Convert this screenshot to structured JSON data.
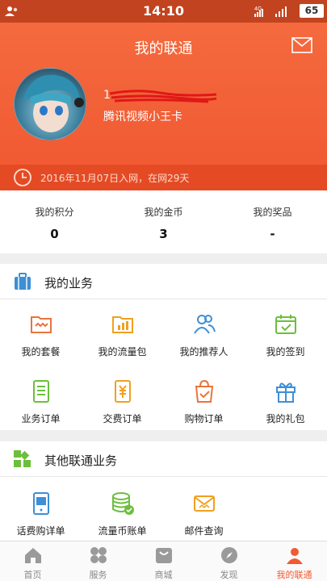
{
  "status_bar": {
    "time": "14:10",
    "battery": "65",
    "network": "4G"
  },
  "header": {
    "title": "我的联通",
    "phone_number": "1",
    "plan_name": "腾讯视频小王卡",
    "join_info": "2016年11月07日入网，在网29天"
  },
  "stats": [
    {
      "label": "我的积分",
      "value": "0"
    },
    {
      "label": "我的金币",
      "value": "3"
    },
    {
      "label": "我的奖品",
      "value": "-"
    }
  ],
  "my_business": {
    "title": "我的业务",
    "items": [
      {
        "label": "我的套餐",
        "icon": "package-icon"
      },
      {
        "label": "我的流量包",
        "icon": "data-pack-icon"
      },
      {
        "label": "我的推荐人",
        "icon": "referrer-icon"
      },
      {
        "label": "我的签到",
        "icon": "checkin-icon"
      },
      {
        "label": "业务订单",
        "icon": "business-order-icon"
      },
      {
        "label": "交费订单",
        "icon": "payment-order-icon"
      },
      {
        "label": "购物订单",
        "icon": "shopping-order-icon"
      },
      {
        "label": "我的礼包",
        "icon": "gift-icon"
      }
    ]
  },
  "other_business": {
    "title": "其他联通业务",
    "items": [
      {
        "label": "话费购详单",
        "icon": "purchase-detail-icon"
      },
      {
        "label": "流量币账单",
        "icon": "coin-bill-icon"
      },
      {
        "label": "邮件查询",
        "icon": "mail-query-icon"
      }
    ]
  },
  "tabs": [
    {
      "label": "首页",
      "icon": "home-icon"
    },
    {
      "label": "服务",
      "icon": "service-icon"
    },
    {
      "label": "商城",
      "icon": "mall-icon"
    },
    {
      "label": "发现",
      "icon": "compass-icon"
    },
    {
      "label": "我的联通",
      "icon": "profile-icon",
      "active": true
    }
  ],
  "colors": {
    "accent": "#f15a33",
    "status_bar": "#c2431f",
    "icon_orange": "#f08a2c",
    "icon_green": "#6cbf3c",
    "icon_blue": "#3d8fd6"
  }
}
